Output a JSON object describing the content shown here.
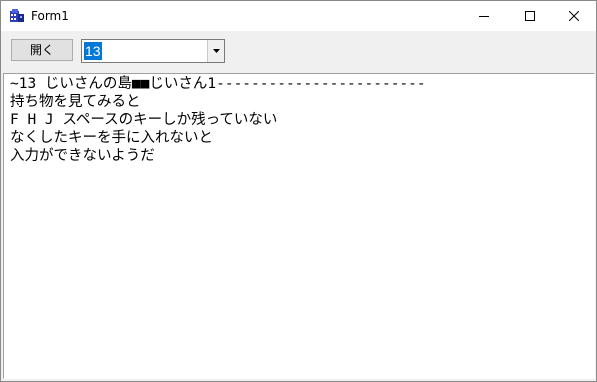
{
  "window": {
    "title": "Form1",
    "icon": "app-icon"
  },
  "toolbar": {
    "open_button_label": "開く",
    "combo_value": "13"
  },
  "content": {
    "lines": [
      "~13 じいさんの島■■じいさん1------------------------",
      "持ち物を見てみると",
      "F H J スペースのキーしか残っていない",
      "なくしたキーを手に入れないと",
      "入力ができないようだ"
    ]
  }
}
